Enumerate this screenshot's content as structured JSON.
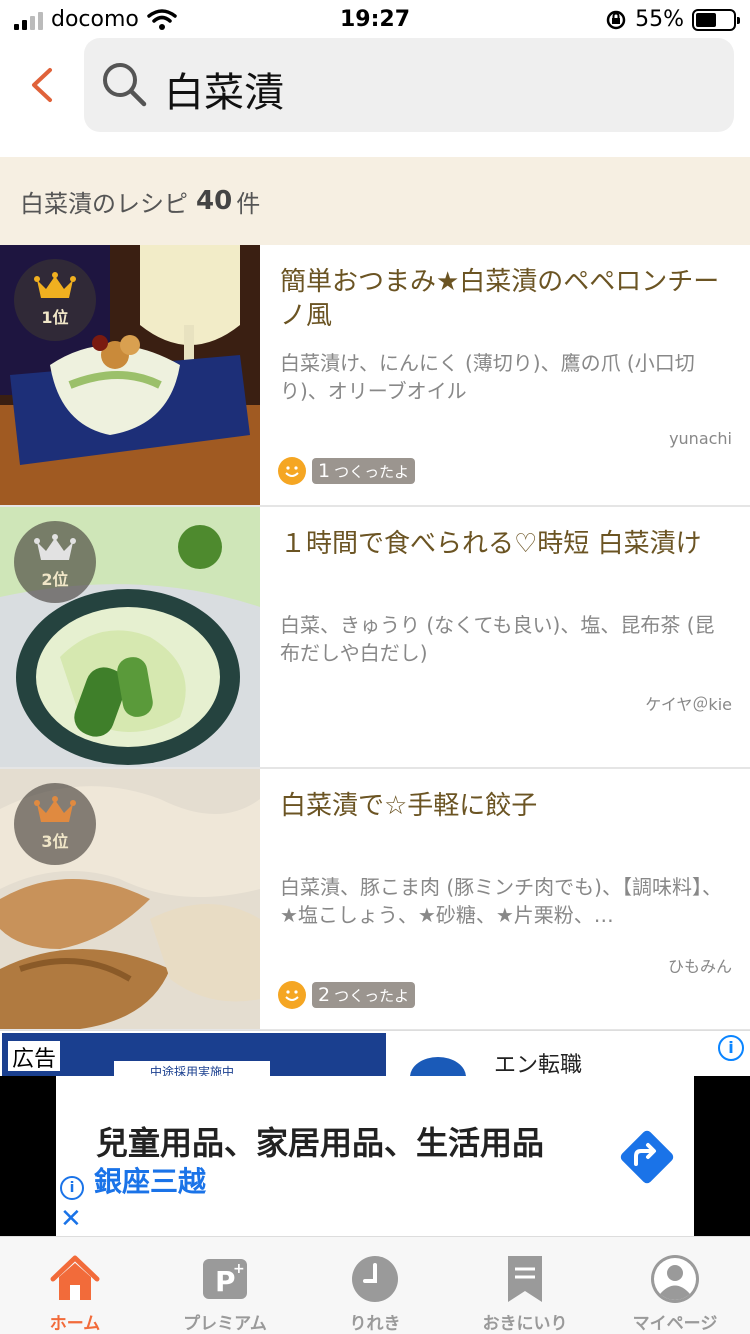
{
  "status_bar": {
    "carrier": "docomo",
    "time": "19:27",
    "battery_percent": "55%",
    "battery_level": 0.55
  },
  "search": {
    "query": "白菜漬"
  },
  "results": {
    "label": "白菜漬のレシピ",
    "count": "40",
    "unit": "件"
  },
  "recipes": [
    {
      "rank": "1位",
      "title": "簡単おつまみ★白菜漬のペペロンチーノ風",
      "ingredients": "白菜漬け、にんにく (薄切り)、鷹の爪 (小口切り)、オリーブオイル",
      "author": "yunachi",
      "made_count": "1",
      "made_label": "つくったよ"
    },
    {
      "rank": "2位",
      "title": "１時間で食べられる♡時短 白菜漬け",
      "ingredients": "白菜、きゅうり (なくても良い)、塩、昆布茶 (昆布だしや白だし)",
      "author": "ケイヤ＠kie"
    },
    {
      "rank": "3位",
      "title": "白菜漬で☆手軽に餃子",
      "ingredients": "白菜漬、豚こま肉 (豚ミンチ肉でも)、【調味料】、★塩こしょう、★砂糖、★片栗粉、…",
      "author": "ひもみん",
      "made_count": "2",
      "made_label": "つくったよ"
    }
  ],
  "ad_inline": {
    "badge": "広告",
    "image_caption": "中途採用実施中",
    "title": "エン転職",
    "info_icon": "i"
  },
  "ad_banner": {
    "text": "兒童用品、家居用品、生活用品",
    "brand": "銀座三越",
    "info_icon": "i",
    "close_icon": "✕"
  },
  "tabs": [
    {
      "label": "ホーム",
      "icon": "home-icon",
      "active": true
    },
    {
      "label": "プレミアム",
      "icon": "premium-icon",
      "active": false
    },
    {
      "label": "りれき",
      "icon": "history-clock-icon",
      "active": false
    },
    {
      "label": "おきにいり",
      "icon": "bookmark-icon",
      "active": false
    },
    {
      "label": "マイページ",
      "icon": "user-icon",
      "active": false
    }
  ],
  "colors": {
    "accent": "#f26b3a",
    "title_brown": "#6b5423",
    "result_bar_bg": "#f6efe2",
    "made_orange": "#f5a623"
  }
}
